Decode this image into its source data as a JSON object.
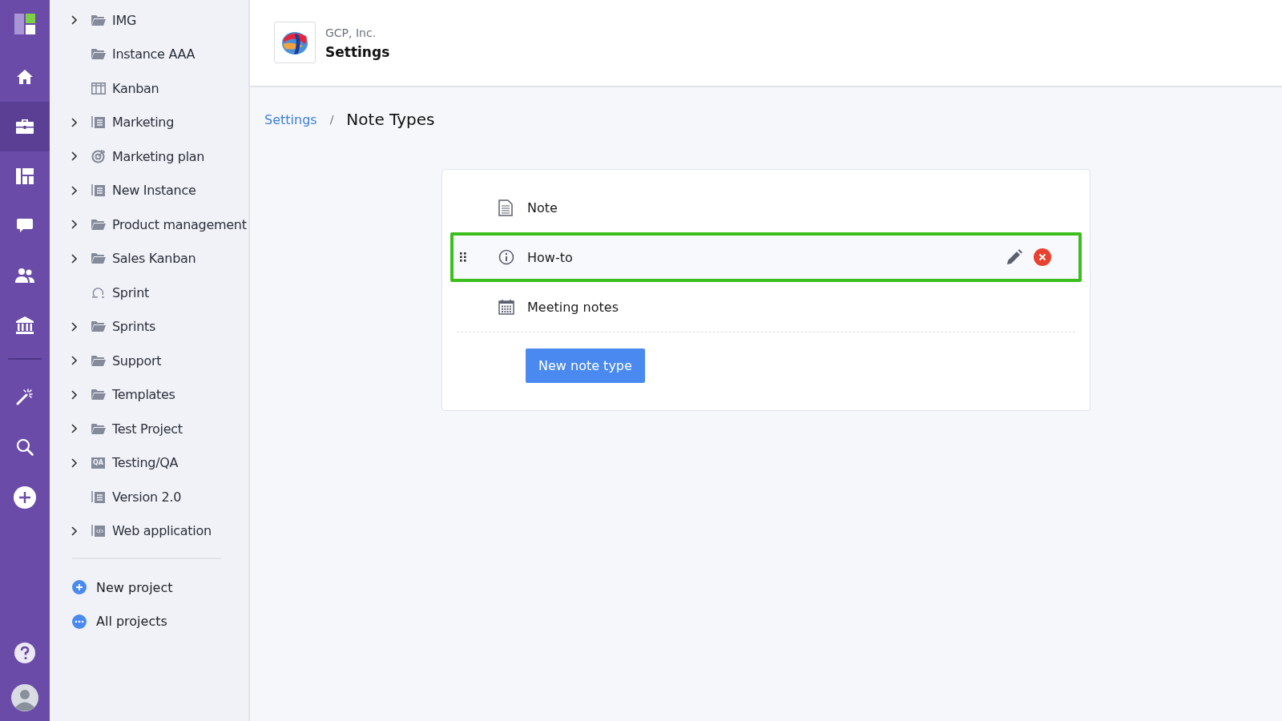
{
  "rail": {
    "items": [
      {
        "kind": "home",
        "selected": false
      },
      {
        "kind": "briefcase",
        "selected": true
      },
      {
        "kind": "dashboard",
        "selected": false
      },
      {
        "kind": "chat",
        "selected": false
      },
      {
        "kind": "people",
        "selected": false
      },
      {
        "kind": "bank",
        "selected": false
      }
    ],
    "tools": [
      {
        "kind": "wand"
      },
      {
        "kind": "search"
      },
      {
        "kind": "plus"
      }
    ]
  },
  "sidebar": {
    "items": [
      {
        "label": "IMG",
        "kind": "folder",
        "expandable": true
      },
      {
        "label": "Instance AAA",
        "kind": "folder",
        "expandable": false
      },
      {
        "label": "Kanban",
        "kind": "board",
        "expandable": false
      },
      {
        "label": "Marketing",
        "kind": "list",
        "expandable": true
      },
      {
        "label": "Marketing plan",
        "kind": "target",
        "expandable": true
      },
      {
        "label": "New Instance",
        "kind": "list",
        "expandable": true
      },
      {
        "label": "Product management",
        "kind": "folder",
        "expandable": true
      },
      {
        "label": "Sales Kanban",
        "kind": "folder",
        "expandable": true
      },
      {
        "label": "Sprint",
        "kind": "loop",
        "expandable": false
      },
      {
        "label": "Sprints",
        "kind": "folder",
        "expandable": true
      },
      {
        "label": "Support",
        "kind": "folder",
        "expandable": true
      },
      {
        "label": "Templates",
        "kind": "folder",
        "expandable": true
      },
      {
        "label": "Test Project",
        "kind": "folder",
        "expandable": true
      },
      {
        "label": "Testing/QA",
        "kind": "qa",
        "expandable": true,
        "badge": "QA"
      },
      {
        "label": "Version 2.0",
        "kind": "list",
        "expandable": false
      },
      {
        "label": "Web application",
        "kind": "code",
        "expandable": true
      }
    ],
    "actions": [
      {
        "label": "New project",
        "kind": "plus"
      },
      {
        "label": "All projects",
        "kind": "more"
      }
    ]
  },
  "header": {
    "company": "GCP, Inc.",
    "title": "Settings"
  },
  "breadcrumb": {
    "link": "Settings",
    "separator": "/",
    "current": "Note Types"
  },
  "note_types": [
    {
      "label": "Note",
      "kind": "document",
      "highlighted": false
    },
    {
      "label": "How-to",
      "kind": "info",
      "highlighted": true
    },
    {
      "label": "Meeting notes",
      "kind": "calendar",
      "highlighted": false
    }
  ],
  "new_button": "New note type"
}
